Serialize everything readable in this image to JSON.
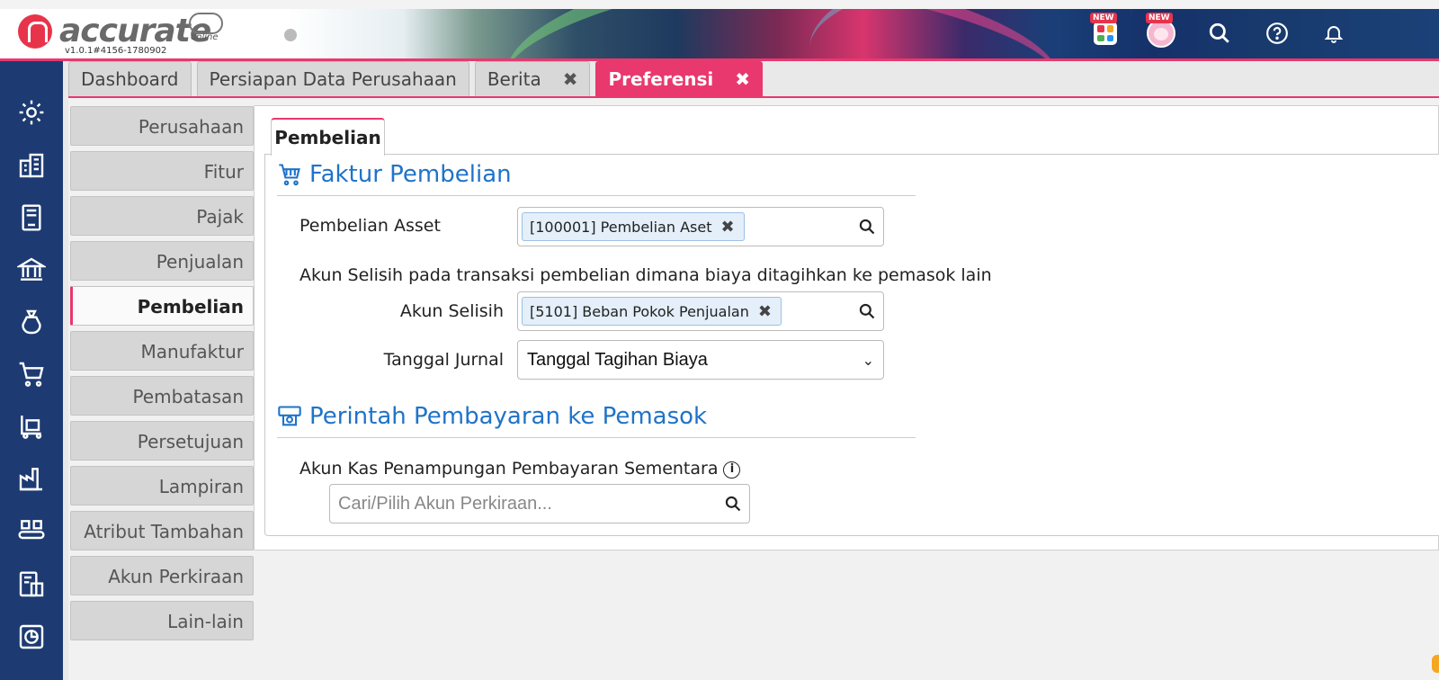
{
  "app": {
    "logo_text": "accurate",
    "logo_sub": "online",
    "version": "v1.0.1#4156-1780902"
  },
  "header": {
    "badge_new_1": "NEW",
    "badge_new_2": "NEW"
  },
  "tabs": [
    {
      "label": "Dashboard",
      "closable": false,
      "active": false
    },
    {
      "label": "Persiapan Data Perusahaan",
      "closable": false,
      "active": false
    },
    {
      "label": "Berita",
      "closable": true,
      "active": false
    },
    {
      "label": "Preferensi",
      "closable": true,
      "active": true
    }
  ],
  "tab_close_glyph": "✖",
  "sidemenu": [
    "Perusahaan",
    "Fitur",
    "Pajak",
    "Penjualan",
    "Pembelian",
    "Manufaktur",
    "Pembatasan",
    "Persetujuan",
    "Lampiran",
    "Atribut Tambahan",
    "Akun Perkiraan",
    "Lain-lain"
  ],
  "sidemenu_active": "Pembelian",
  "subtab": "Pembelian",
  "faktur": {
    "title": "Faktur Pembelian",
    "asset_label": "Pembelian Asset",
    "asset_value": "[100001] Pembelian Aset",
    "selisih_note": "Akun Selisih pada transaksi pembelian dimana biaya ditagihkan ke pemasok lain",
    "selisih_label": "Akun Selisih",
    "selisih_value": "[5101] Beban Pokok Penjualan",
    "tanggal_label": "Tanggal Jurnal",
    "tanggal_value": "Tanggal Tagihan Biaya"
  },
  "perintah": {
    "title": "Perintah Pembayaran ke Pemasok",
    "kas_label": "Akun Kas Penampungan Pembayaran Sementara",
    "kas_placeholder": "Cari/Pilih Akun Perkiraan..."
  },
  "colors": {
    "accent": "#e8386e",
    "sidebar": "#1d3b72",
    "section_title": "#1f73c9"
  }
}
